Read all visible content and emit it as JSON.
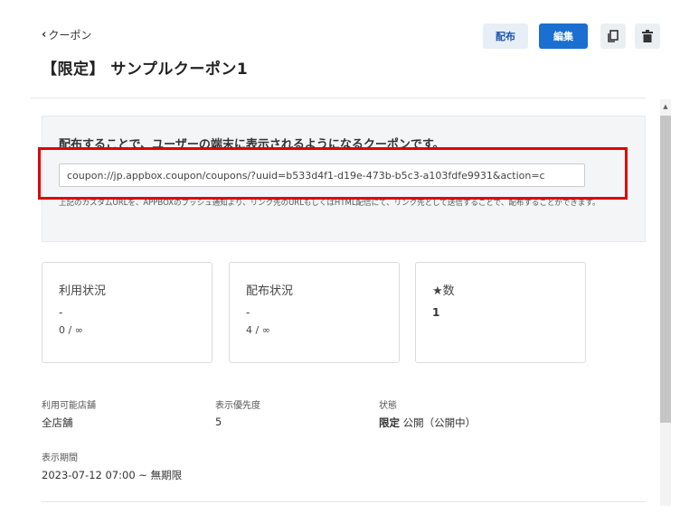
{
  "header": {
    "back_label": "クーポン",
    "title": "【限定】 サンプルクーポン1",
    "distribute_label": "配布",
    "edit_label": "編集"
  },
  "info": {
    "heading": "配布することで、ユーザーの端末に表示されるようになるクーポンです。",
    "url_value": "coupon://jp.appbox.coupon/coupons/?uuid=b533d4f1-d19e-473b-b5c3-a103fdfe9931&action=c",
    "note": "上記のカスタムURLを、APPBOXのプッシュ通知より、リンク先のURLもしくはHTML配信にて、リンク先として送信することで、配布することができます。"
  },
  "cards": {
    "usage": {
      "label": "利用状況",
      "dash": "-",
      "count": "0 / ∞"
    },
    "distribution": {
      "label": "配布状況",
      "dash": "-",
      "count": "4 / ∞"
    },
    "stars": {
      "label": "★数",
      "value": "1"
    }
  },
  "meta": {
    "stores_label": "利用可能店舗",
    "stores_value": "全店舗",
    "priority_label": "表示優先度",
    "priority_value": "5",
    "status_label": "状態",
    "status_limited": "限定",
    "status_value": "公開（公開中）",
    "period_label": "表示期間",
    "period_value": "2023-07-12 07:00 ~ 無期限"
  },
  "icons": {
    "back": "chevron-left-icon",
    "copy": "copy-icon",
    "delete": "trash-icon"
  },
  "colors": {
    "primary": "#1a6fd1",
    "highlight": "#e00000"
  }
}
